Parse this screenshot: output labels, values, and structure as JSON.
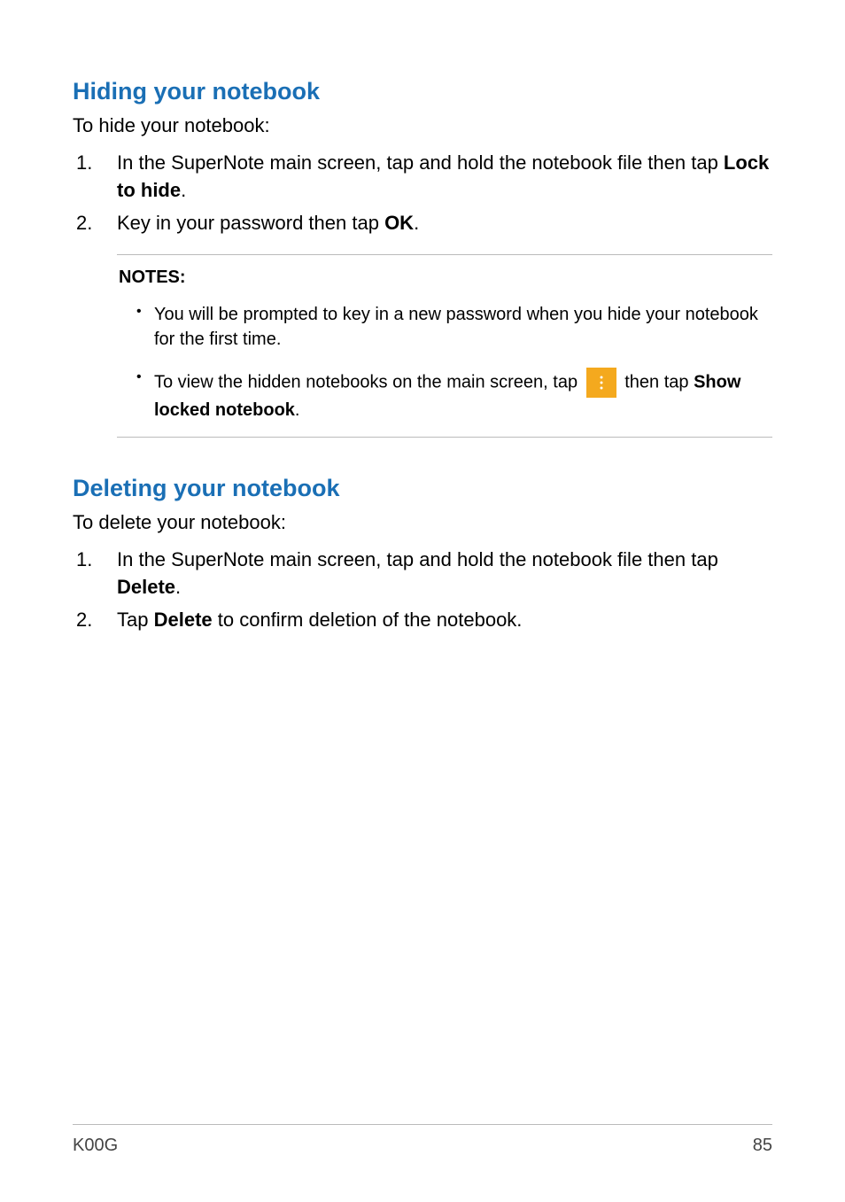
{
  "section1": {
    "heading": "Hiding your notebook",
    "intro": "To hide your notebook:",
    "steps": [
      {
        "num": "1.",
        "text_before": "In the SuperNote main screen, tap and hold the notebook file then tap ",
        "bold1": "Lock to hide",
        "text_after": "."
      },
      {
        "num": "2.",
        "text_before": "Key in your password then tap ",
        "bold1": "OK",
        "text_after": "."
      }
    ]
  },
  "notes": {
    "title_bold": "NOTES",
    "title_colon": ":",
    "item1": "You will be prompted to key in a new password when you hide your notebook for the first time.",
    "item2_before": "To view the hidden notebooks on the main screen, tap ",
    "item2_after": " then tap ",
    "item2_bold": "Show locked notebook",
    "item2_end": "."
  },
  "section2": {
    "heading": "Deleting your notebook",
    "intro": "To delete your notebook:",
    "steps": [
      {
        "num": "1.",
        "text_before": "In the SuperNote main screen, tap and hold the notebook file then tap ",
        "bold1": "Delete",
        "text_after": "."
      },
      {
        "num": "2.",
        "text_before": "Tap ",
        "bold1": "Delete",
        "text_after": " to confirm deletion of the notebook."
      }
    ]
  },
  "footer": {
    "left": "K00G",
    "right": "85"
  }
}
